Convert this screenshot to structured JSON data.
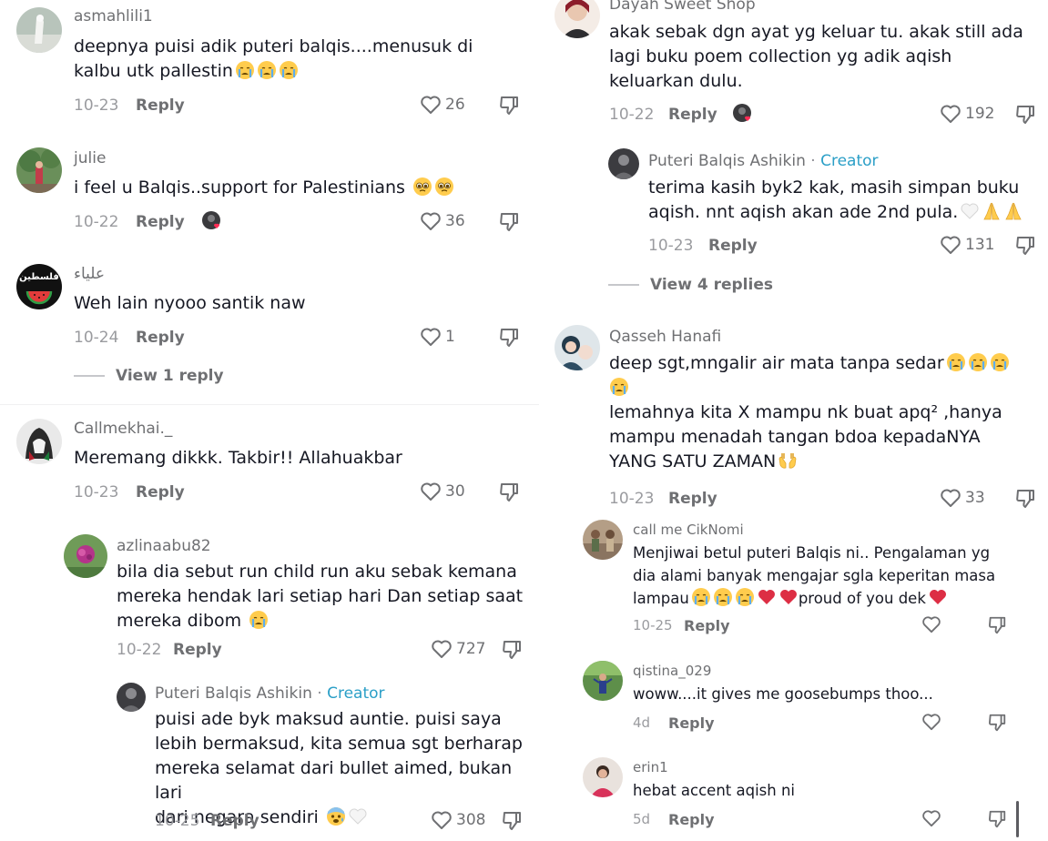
{
  "left": {
    "c1": {
      "username": "asmahlili1",
      "text": "deepnya puisi adik puteri balqis....menusuk di kalbu utk pallestin",
      "emojis": [
        "crying-face",
        "crying-face",
        "crying-face"
      ],
      "date": "10-23",
      "reply": "Reply",
      "likes": "26"
    },
    "c2": {
      "username": "julie",
      "text": "i feel u Balqis..support for Palestinians",
      "emojis": [
        "pleading-face",
        "pleading-face"
      ],
      "date": "10-22",
      "reply": "Reply",
      "likes": "36"
    },
    "c3": {
      "username": "علياء",
      "avatar_text": "فلسطين",
      "text": "Weh lain nyooo santik naw",
      "date": "10-24",
      "reply": "Reply",
      "likes": "1",
      "view_replies": "View 1 reply"
    },
    "c4": {
      "username": "Callmekhai._",
      "text": "Meremang dikkk. Takbir!! Allahuakbar",
      "date": "10-23",
      "reply": "Reply",
      "likes": "30"
    },
    "r1": {
      "username": "azlinaabu82",
      "line1": "bila dia sebut run child run aku sebak kemana",
      "line2": "mereka hendak lari setiap hari Dan setiap saat",
      "line3": "mereka dibom",
      "emojis": [
        "crying-face"
      ],
      "date": "10-22",
      "reply": "Reply",
      "likes": "727"
    },
    "r2": {
      "username": "Puteri Balqis Ashikin",
      "separator": "·",
      "creator": "Creator",
      "line1": "puisi ade byk maksud auntie. puisi saya",
      "line2": "lebih bermaksud, kita semua sgt berharap",
      "line3": "mereka selamat dari bullet aimed, bukan lari",
      "line4": "dari negara sendiri",
      "emojis": [
        "anxious-face",
        "white-heart"
      ],
      "date": "10-25",
      "reply": "Reply",
      "likes": "308"
    }
  },
  "right": {
    "c1": {
      "username": "Dayah Sweet Shop",
      "line1": "akak sebak dgn ayat yg keluar tu. akak still ada",
      "line2": "lagi buku poem collection yg adik aqish",
      "line3": "keluarkan dulu.",
      "date": "10-22",
      "reply": "Reply",
      "likes": "192"
    },
    "r1": {
      "username": "Puteri Balqis Ashikin",
      "separator": "·",
      "creator": "Creator",
      "line1": "terima kasih byk2 kak, masih simpan buku",
      "line2": "aqish. nnt aqish akan ade 2nd pula.",
      "emojis": [
        "white-heart",
        "folded-hands",
        "folded-hands"
      ],
      "date": "10-23",
      "reply": "Reply",
      "likes": "131",
      "view_replies": "View 4 replies"
    },
    "c2": {
      "username": "Qasseh Hanafi",
      "line1": "deep sgt,mngalir air mata tanpa sedar",
      "line3": "lemahnya kita X mampu nk buat apq² ,hanya",
      "line4": "mampu menadah tangan bdoa kepadaNYA",
      "line5": "YANG SATU ZAMAN",
      "emojis1": [
        "crying-face",
        "crying-face",
        "crying-face",
        "crying-face"
      ],
      "emojis2": [
        "palms-up"
      ],
      "date": "10-23",
      "reply": "Reply",
      "likes": "33"
    },
    "r2": {
      "username": "call me CikNomi",
      "line1": "Menjiwai betul puteri Balqis ni.. Pengalaman yg",
      "line2": "dia alami banyak mengajar sgla keperitan masa",
      "line3": "lampau",
      "line3b": "proud of you dek",
      "emojis1": [
        "crying-face",
        "crying-face",
        "crying-face",
        "red-heart",
        "red-heart"
      ],
      "emojis2": [
        "red-heart"
      ],
      "date": "10-25",
      "reply": "Reply"
    },
    "r3": {
      "username": "qistina_029",
      "text": "woww....it gives me goosebumps thoo...",
      "date": "4d",
      "reply": "Reply"
    },
    "r4": {
      "username": "erin1",
      "text": "hebat accent aqish ni",
      "date": "5d",
      "reply": "Reply"
    }
  },
  "colors": {
    "username": "#6f7073",
    "text": "#161823",
    "meta": "#9a9b9f",
    "creator": "#2b9fc7",
    "heart_red": "#fe2c55"
  }
}
